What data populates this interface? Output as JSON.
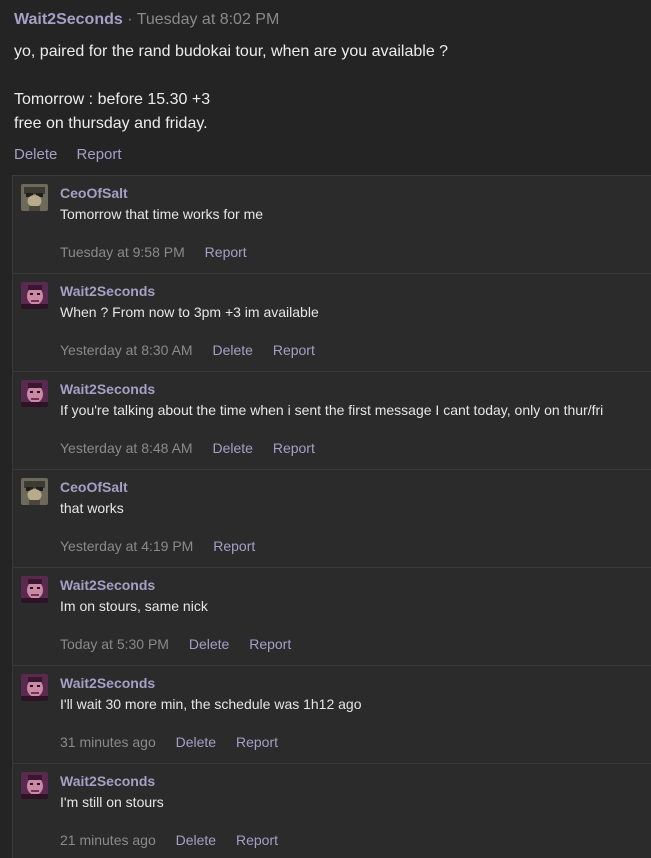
{
  "post": {
    "author": "Wait2Seconds",
    "separator": "·",
    "timestamp": "Tuesday at 8:02 PM",
    "body_line1": "yo, paired for the rand budokai tour, when are you available ?",
    "body_line2": "Tomorrow : before 15.30 +3",
    "body_line3": "free on thursday and friday.",
    "delete_label": "Delete",
    "report_label": "Report"
  },
  "comments": [
    {
      "author": "CeoOfSalt",
      "text": "Tomorrow that time works for me",
      "time": "Tuesday at 9:58 PM",
      "report_label": "Report",
      "avatar": "ceoofsalt-avatar"
    },
    {
      "author": "Wait2Seconds",
      "text": "When ? From now to 3pm +3 im available",
      "time": "Yesterday at 8:30 AM",
      "delete_label": "Delete",
      "report_label": "Report",
      "avatar": "wait2seconds-avatar"
    },
    {
      "author": "Wait2Seconds",
      "text": "If you're talking about the time when i sent the first message I cant today, only on thur/fri",
      "time": "Yesterday at 8:48 AM",
      "delete_label": "Delete",
      "report_label": "Report",
      "avatar": "wait2seconds-avatar"
    },
    {
      "author": "CeoOfSalt",
      "text": "that works",
      "time": "Yesterday at 4:19 PM",
      "report_label": "Report",
      "avatar": "ceoofsalt-avatar"
    },
    {
      "author": "Wait2Seconds",
      "text": "Im on stours, same nick",
      "time": "Today at 5:30 PM",
      "delete_label": "Delete",
      "report_label": "Report",
      "avatar": "wait2seconds-avatar"
    },
    {
      "author": "Wait2Seconds",
      "text": "I'll wait 30 more min, the schedule was 1h12 ago",
      "time": "31 minutes ago",
      "delete_label": "Delete",
      "report_label": "Report",
      "avatar": "wait2seconds-avatar"
    },
    {
      "author": "Wait2Seconds",
      "text": "I'm still on stours",
      "time": "21 minutes ago",
      "delete_label": "Delete",
      "report_label": "Report",
      "avatar": "wait2seconds-avatar"
    }
  ],
  "colors": {
    "background": "#242424",
    "comment_background": "#2b2b2b",
    "accent": "#a69fc6",
    "muted": "#8a8a8a"
  }
}
